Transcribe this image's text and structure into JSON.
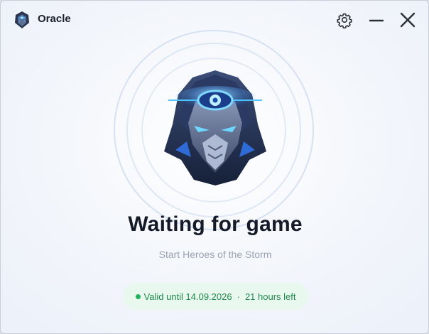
{
  "window": {
    "title": "Oracle",
    "icons": {
      "app": "hooded-guardian-logo-icon",
      "settings": "gear-icon",
      "minimize": "minimize-icon",
      "close": "close-icon"
    }
  },
  "main": {
    "emblem": "hooded-guardian-emblem",
    "status_title": "Waiting for game",
    "status_subtitle": "Start Heroes of the Storm"
  },
  "license": {
    "valid_text": "Valid until 14.09.2026",
    "separator": "·",
    "remaining_text": "21 hours left",
    "status_color": "#20b15a"
  },
  "colors": {
    "accent_blue": "#2f8dff",
    "text_dark": "#141a28",
    "text_muted": "#9aa3b2",
    "badge_bg": "#e8f8ee",
    "badge_text": "#1f8a4c"
  }
}
